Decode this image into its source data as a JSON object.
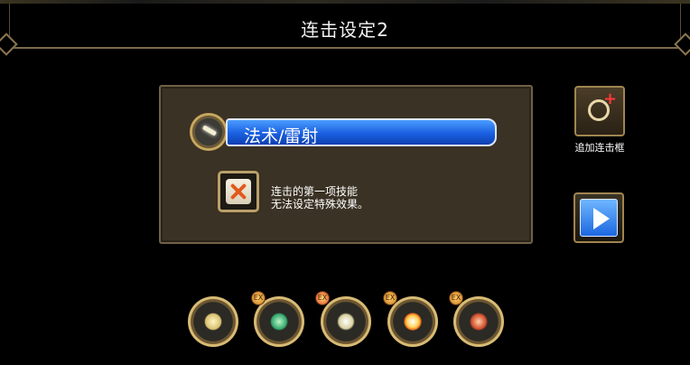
{
  "header": {
    "title": "连击设定2"
  },
  "panel": {
    "skill_name": "法术/雷射",
    "notice_line1": "连击的第一项技能",
    "notice_line2": "无法设定特殊效果。"
  },
  "side": {
    "add_label": "追加连击框"
  },
  "combo_slots": [
    {
      "icon": "beam-skill-icon",
      "badge": false
    },
    {
      "icon": "wind-skill-icon",
      "badge": true
    },
    {
      "icon": "slash-skill-icon",
      "badge": true
    },
    {
      "icon": "burst-skill-icon",
      "badge": true
    },
    {
      "icon": "flame-skill-icon",
      "badge": true
    }
  ],
  "colors": {
    "accent_blue": "#1a5fe0",
    "gold": "#d8bb74",
    "cancel_orange": "#e2591c"
  }
}
